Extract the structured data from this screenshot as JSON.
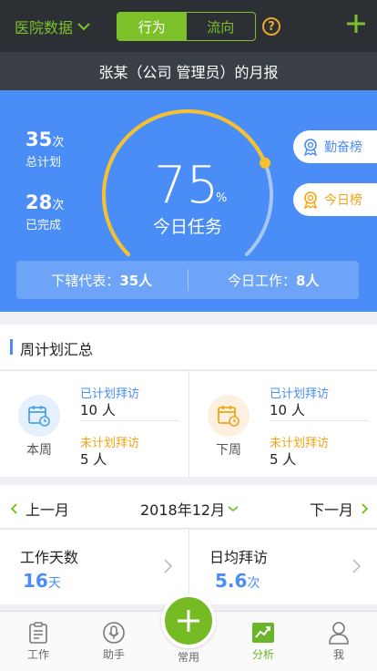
{
  "header": {
    "hospital_selector": "医院数据",
    "segments": [
      "行为",
      "流向"
    ],
    "help_label": "?",
    "subtitle": "张某（公司 管理员）的月报"
  },
  "panel": {
    "planned_num": "35",
    "planned_unit": "次",
    "planned_label": "总计划",
    "done_num": "28",
    "done_unit": "次",
    "done_label": "已完成",
    "gauge_percent": "75",
    "gauge_percent_value": 0.75,
    "gauge_percent_sign": "%",
    "gauge_label": "今日任务",
    "rank_buttons": [
      "勤奋榜",
      "今日榜"
    ],
    "subordinates": "下辖代表：",
    "subordinates_value": "35人",
    "today_work": "今日工作：",
    "today_work_value": "8人"
  },
  "weekly": {
    "title": "周计划汇总",
    "this_week": {
      "label": "本周",
      "planned_label": "已计划拜访",
      "planned_value": "10 人",
      "unplanned_label": "未计划拜访",
      "unplanned_value": "5 人"
    },
    "next_week": {
      "label": "下周",
      "planned_label": "已计划拜访",
      "planned_value": "10 人",
      "unplanned_label": "未计划拜访",
      "unplanned_value": "5 人"
    }
  },
  "month_nav": {
    "prev": "上一月",
    "current": "2018年12月",
    "next": "下一月"
  },
  "metrics": {
    "work_days_title": "工作天数",
    "work_days_value": "16",
    "work_days_unit": "天",
    "avg_visits_title": "日均拜访",
    "avg_visits_value": "5.6",
    "avg_visits_unit": "次"
  },
  "tabbar": {
    "items": [
      "工作",
      "助手",
      "常用",
      "分析",
      "我"
    ],
    "active": "分析"
  },
  "colors": {
    "accent_green": "#7cc12a",
    "panel_blue": "#4b8df6",
    "gauge_yellow": "#f8c02a",
    "rank_orange": "#f2a415"
  }
}
